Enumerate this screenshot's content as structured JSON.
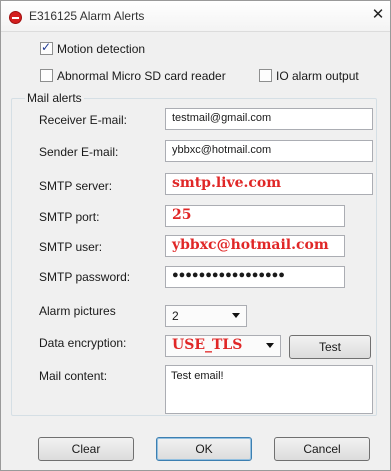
{
  "window": {
    "title": "E316125 Alarm Alerts",
    "close_glyph": "✕"
  },
  "options": {
    "motion_detection": {
      "label": "Motion detection",
      "checked": true
    },
    "abnormal_sd": {
      "label": "Abnormal Micro SD card reader",
      "checked": false
    },
    "io_alarm": {
      "label": "IO alarm output",
      "checked": false
    }
  },
  "mail": {
    "group_title": "Mail alerts",
    "receiver": {
      "label": "Receiver E-mail:",
      "value": "testmail@gmail.com"
    },
    "sender": {
      "label": "Sender E-mail:",
      "value": "ybbxc@hotmail.com"
    },
    "smtp_server": {
      "label": "SMTP server:",
      "value": "smtp.live.com"
    },
    "smtp_port": {
      "label": "SMTP port:",
      "value": "25"
    },
    "smtp_user": {
      "label": "SMTP user:",
      "value": "ybbxc@hotmail.com"
    },
    "smtp_password": {
      "label": "SMTP password:",
      "value": "●●●●●●●●●●●●●●●●●"
    },
    "alarm_pictures": {
      "label": "Alarm pictures",
      "value": "2"
    },
    "encryption": {
      "label": "Data encryption:",
      "value": "USE_TLS",
      "test_label": "Test"
    },
    "content": {
      "label": "Mail content:",
      "value": "Test email!"
    }
  },
  "buttons": {
    "clear": "Clear",
    "ok": "OK",
    "cancel": "Cancel"
  },
  "colors": {
    "highlight_text": "#e02727",
    "close_icon": "#d41f1f"
  }
}
